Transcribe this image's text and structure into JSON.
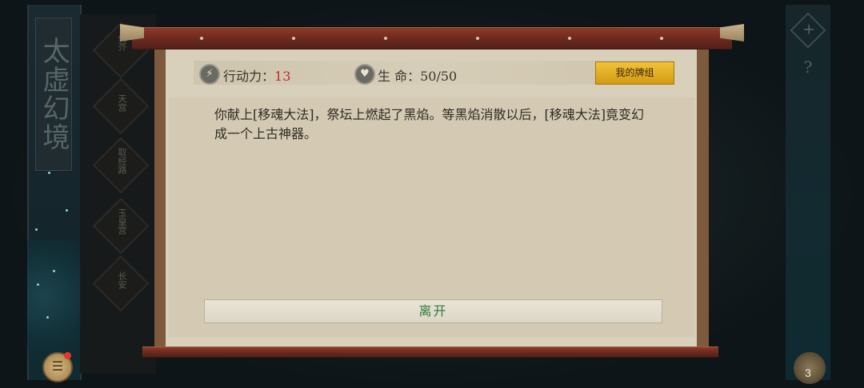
{
  "left_panel": {
    "title": "太虚幻境"
  },
  "side_menu": {
    "items": [
      "伐芥",
      "天宫",
      "取经路",
      "玉皇宫",
      "长安"
    ]
  },
  "status": {
    "action_label": "行动力：",
    "action_value": "13",
    "life_label": "生 命：",
    "life_value": "50/50",
    "deck_button": "我的牌组"
  },
  "event": {
    "text": "你献上[移魂大法]，祭坛上燃起了黑焰。等黑焰消散以后，[移魂大法]竟变幻成一个上古神器。"
  },
  "leave_button": "离开",
  "deck_count": "3",
  "right_panel": {
    "question_mark": "?"
  },
  "icons": {
    "action": "lightning-icon",
    "life": "heart-icon",
    "chat": "chat-icon",
    "deck": "deck-icon",
    "close": "close-icon"
  },
  "colors": {
    "action_value": "#c1272d",
    "leave_text": "#2f7a3a",
    "deck_tab": "#e0ac22"
  }
}
